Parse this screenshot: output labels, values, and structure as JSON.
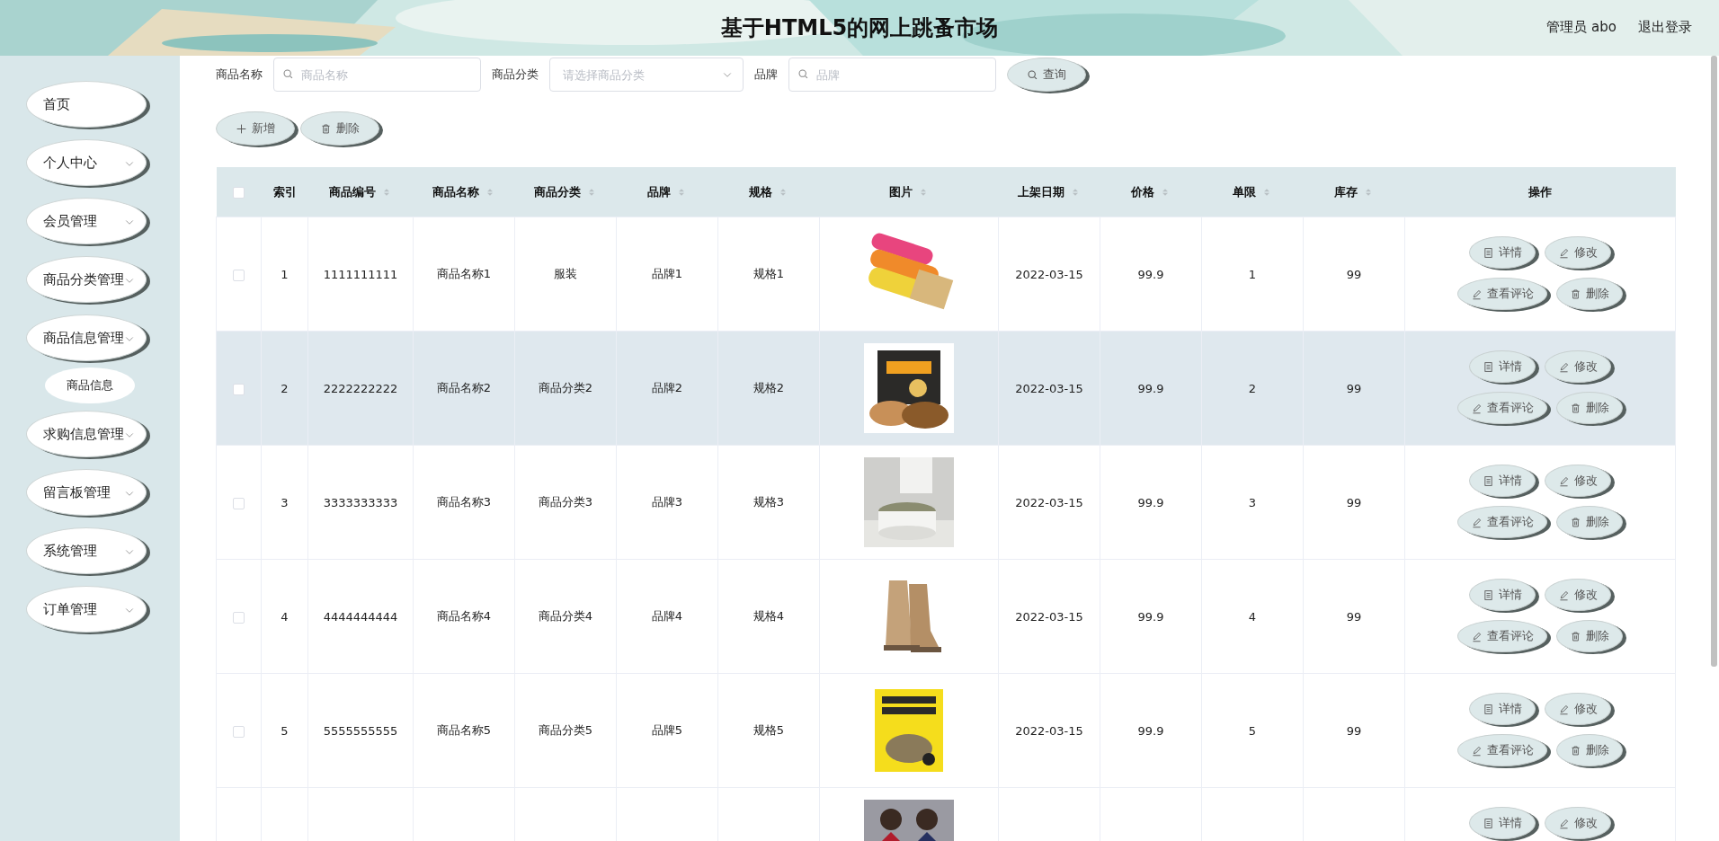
{
  "header": {
    "title": "基于HTML5的网上跳蚤市场",
    "user": "管理员 abo",
    "logout": "退出登录"
  },
  "sidebar": {
    "items": [
      {
        "label": "首页",
        "expandable": false
      },
      {
        "label": "个人中心",
        "expandable": true
      },
      {
        "label": "会员管理",
        "expandable": true
      },
      {
        "label": "商品分类管理",
        "expandable": true
      },
      {
        "label": "商品信息管理",
        "expandable": true,
        "children": [
          {
            "label": "商品信息"
          }
        ]
      },
      {
        "label": "求购信息管理",
        "expandable": true
      },
      {
        "label": "留言板管理",
        "expandable": true
      },
      {
        "label": "系统管理",
        "expandable": true
      },
      {
        "label": "订单管理",
        "expandable": true
      }
    ]
  },
  "search": {
    "fields": [
      {
        "label": "商品名称",
        "kind": "text",
        "placeholder": "商品名称"
      },
      {
        "label": "商品分类",
        "kind": "select",
        "placeholder": "请选择商品分类"
      },
      {
        "label": "品牌",
        "kind": "text",
        "placeholder": "品牌"
      }
    ],
    "button": "查询"
  },
  "toolbar": [
    {
      "label": "新增",
      "kind": "add"
    },
    {
      "label": "删除",
      "kind": "delete"
    }
  ],
  "table": {
    "columns": [
      {
        "kind": "checkbox",
        "checked": false
      },
      {
        "kind": "text",
        "label": "索引",
        "sortable": false
      },
      {
        "kind": "text",
        "label": "商品编号",
        "sortable": true
      },
      {
        "kind": "text",
        "label": "商品名称",
        "sortable": true
      },
      {
        "kind": "text",
        "label": "商品分类",
        "sortable": true
      },
      {
        "kind": "text",
        "label": "品牌",
        "sortable": true
      },
      {
        "kind": "text",
        "label": "规格",
        "sortable": true
      },
      {
        "kind": "picture",
        "label": "图片",
        "sortable": true
      },
      {
        "kind": "text",
        "label": "上架日期",
        "sortable": true
      },
      {
        "kind": "text",
        "label": "价格",
        "sortable": true
      },
      {
        "kind": "text",
        "label": "单限",
        "sortable": true
      },
      {
        "kind": "text",
        "label": "库存",
        "sortable": true
      },
      {
        "kind": "actions",
        "label": "操作",
        "sortable": false
      }
    ],
    "rows": [
      {
        "checked": false,
        "highlighted": false,
        "cells": [
          "1",
          "1111111111",
          "商品名称1",
          "服装",
          "品牌1",
          "规格1",
          "2022-03-15",
          "99.9",
          "1",
          "99"
        ],
        "picture": {
          "kind": "picture"
        },
        "actions": [
          {
            "label": "详情",
            "kind": "detail"
          },
          {
            "label": "修改",
            "kind": "edit"
          },
          {
            "label": "查看评论",
            "kind": "edit"
          },
          {
            "label": "删除",
            "kind": "delete"
          }
        ]
      },
      {
        "checked": false,
        "highlighted": true,
        "cells": [
          "2",
          "2222222222",
          "商品名称2",
          "商品分类2",
          "品牌2",
          "规格2",
          "2022-03-15",
          "99.9",
          "2",
          "99"
        ],
        "picture": {
          "kind": "picture"
        },
        "actions": [
          {
            "label": "详情",
            "kind": "detail"
          },
          {
            "label": "修改",
            "kind": "edit"
          },
          {
            "label": "查看评论",
            "kind": "edit"
          },
          {
            "label": "删除",
            "kind": "delete"
          }
        ]
      },
      {
        "checked": false,
        "highlighted": false,
        "cells": [
          "3",
          "3333333333",
          "商品名称3",
          "商品分类3",
          "品牌3",
          "规格3",
          "2022-03-15",
          "99.9",
          "3",
          "99"
        ],
        "picture": {
          "kind": "picture"
        },
        "actions": [
          {
            "label": "详情",
            "kind": "detail"
          },
          {
            "label": "修改",
            "kind": "edit"
          },
          {
            "label": "查看评论",
            "kind": "edit"
          },
          {
            "label": "删除",
            "kind": "delete"
          }
        ]
      },
      {
        "checked": false,
        "highlighted": false,
        "cells": [
          "4",
          "4444444444",
          "商品名称4",
          "商品分类4",
          "品牌4",
          "规格4",
          "2022-03-15",
          "99.9",
          "4",
          "99"
        ],
        "picture": {
          "kind": "picture"
        },
        "actions": [
          {
            "label": "详情",
            "kind": "detail"
          },
          {
            "label": "修改",
            "kind": "edit"
          },
          {
            "label": "查看评论",
            "kind": "edit"
          },
          {
            "label": "删除",
            "kind": "delete"
          }
        ]
      },
      {
        "checked": false,
        "highlighted": false,
        "cells": [
          "5",
          "5555555555",
          "商品名称5",
          "商品分类5",
          "品牌5",
          "规格5",
          "2022-03-15",
          "99.9",
          "5",
          "99"
        ],
        "picture": {
          "kind": "picture"
        },
        "actions": [
          {
            "label": "详情",
            "kind": "detail"
          },
          {
            "label": "修改",
            "kind": "edit"
          },
          {
            "label": "查看评论",
            "kind": "edit"
          },
          {
            "label": "删除",
            "kind": "delete"
          }
        ]
      },
      {
        "highlighted": false,
        "picture": {
          "kind": "picture"
        },
        "actions": [
          {
            "label": "详情",
            "kind": "detail"
          },
          {
            "label": "修改",
            "kind": "edit"
          }
        ]
      }
    ]
  }
}
